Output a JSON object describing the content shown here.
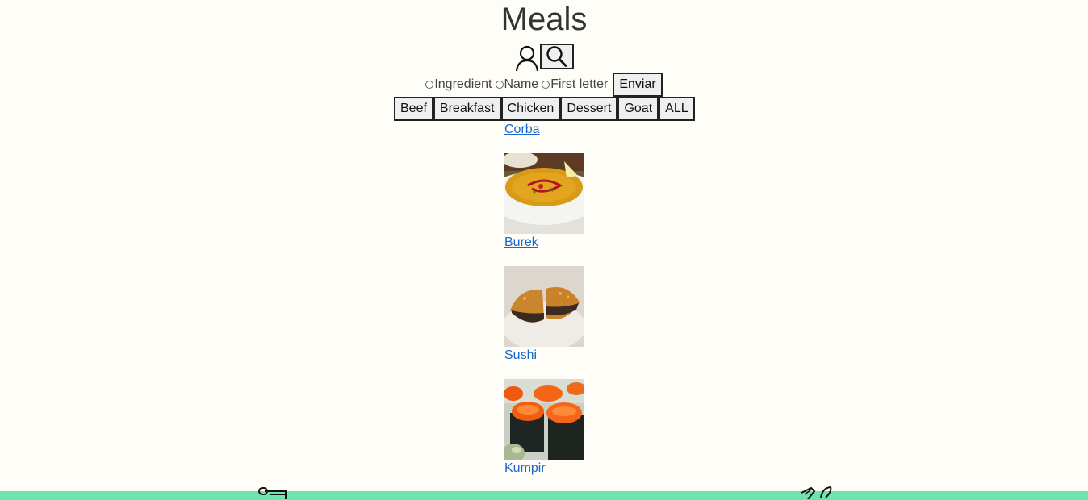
{
  "header": {
    "title": "Meals"
  },
  "icons": {
    "profile": "profile-icon",
    "search": "search-icon",
    "footer_left": "drinks-icon",
    "footer_right": "explore-icon"
  },
  "search_form": {
    "options": [
      "Ingredient",
      "Name",
      "First letter"
    ],
    "submit_label": "Enviar"
  },
  "categories": [
    "Beef",
    "Breakfast",
    "Chicken",
    "Dessert",
    "Goat",
    "ALL"
  ],
  "meals": [
    {
      "name": "Corba",
      "image": "soup"
    },
    {
      "name": "Burek",
      "image": "pastry"
    },
    {
      "name": "Sushi",
      "image": "sushi"
    },
    {
      "name": "Kumpir",
      "image": ""
    }
  ],
  "colors": {
    "background": "#fffdf8",
    "footer": "#6fe3ad",
    "link": "#1a66cc"
  }
}
